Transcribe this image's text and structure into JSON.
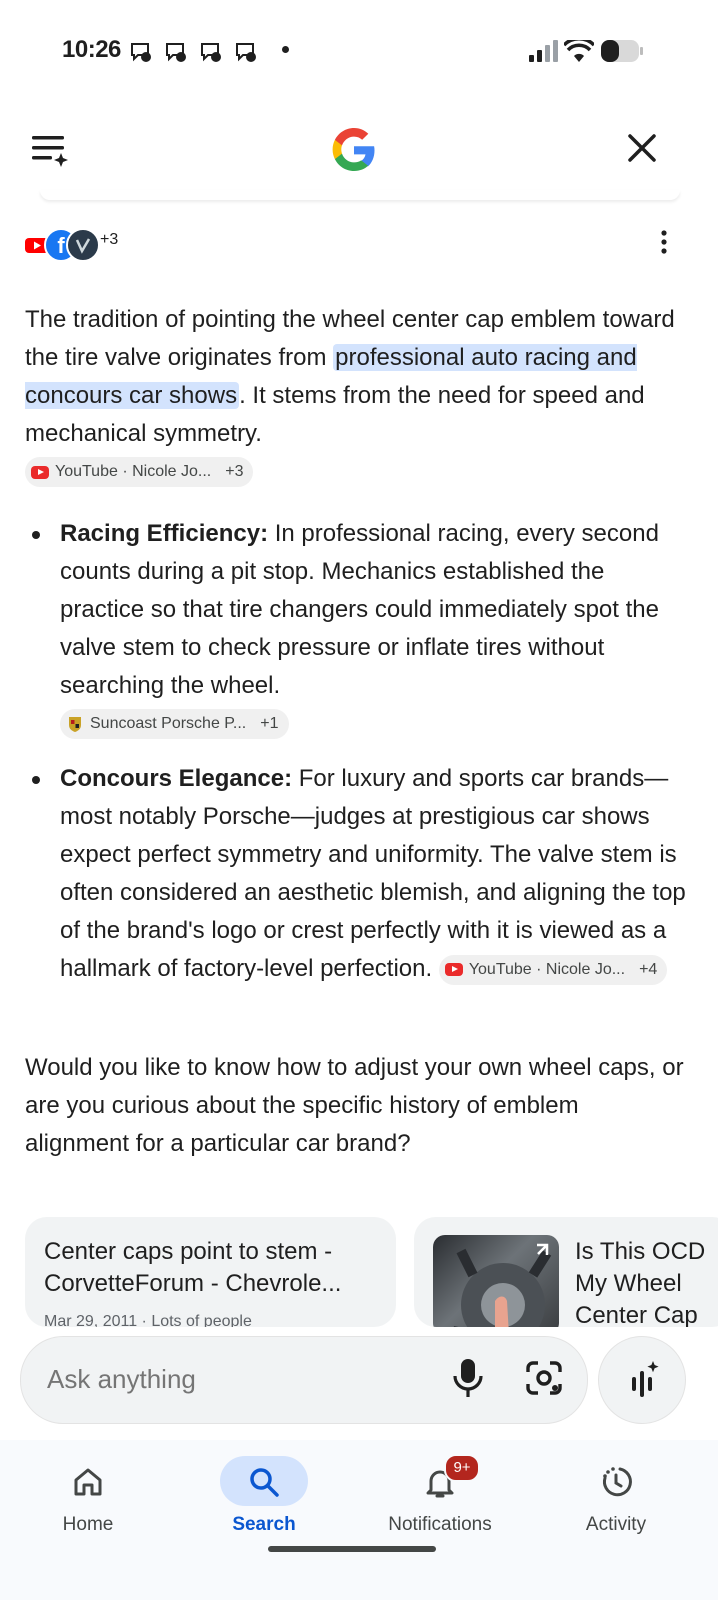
{
  "status_bar": {
    "time": "10:26"
  },
  "header": {
    "logo": "google-g-logo",
    "menu_icon": "menu-sparkle-icon",
    "close_icon": "close-icon"
  },
  "sources": {
    "more_count": "+3"
  },
  "intro": {
    "text_before": "The tradition of pointing the wheel center cap emblem toward the tire valve originates from ",
    "highlight": "professional auto racing and concours car shows",
    "text_after": ". It stems from the need for speed and mechanical symmetry.",
    "chip_source": "YouTube · Nicole Jo...",
    "chip_count": "+3"
  },
  "bullets": [
    {
      "title": "Racing Efficiency:",
      "text": " In professional racing, every second counts during a pit stop. Mechanics established the practice so that tire changers could immediately spot the valve stem to check pressure or inflate tires without searching the wheel.",
      "chip_source": "Suncoast Porsche P...",
      "chip_count": "+1"
    },
    {
      "title": "Concours Elegance:",
      "text": " For luxury and sports car brands—most notably Porsche—judges at prestigious car shows expect perfect symmetry and uniformity. The valve stem is often considered an aesthetic blemish, and aligning the top of the brand's logo or crest perfectly with it is viewed as a hallmark of factory-level perfection.",
      "chip_source": "YouTube · Nicole Jo...",
      "chip_count": "+4"
    }
  ],
  "followup": "Would you like to know how to adjust your own wheel caps, or are you curious about the specific history of emblem alignment for a particular car brand?",
  "cards": [
    {
      "title": "Center caps point to stem - CorvetteForum - Chevrole...",
      "meta": "Mar 29, 2011 · Lots of people"
    },
    {
      "title": "Is This OCD\nMy Wheel\nCenter Cap"
    }
  ],
  "ask": {
    "placeholder": "Ask anything"
  },
  "nav": {
    "home": "Home",
    "search": "Search",
    "notifications": "Notifications",
    "notifications_badge": "9+",
    "activity": "Activity"
  },
  "colors": {
    "accent": "#0b57d0",
    "highlight": "#d3e3fd",
    "badge": "#b3261e"
  }
}
